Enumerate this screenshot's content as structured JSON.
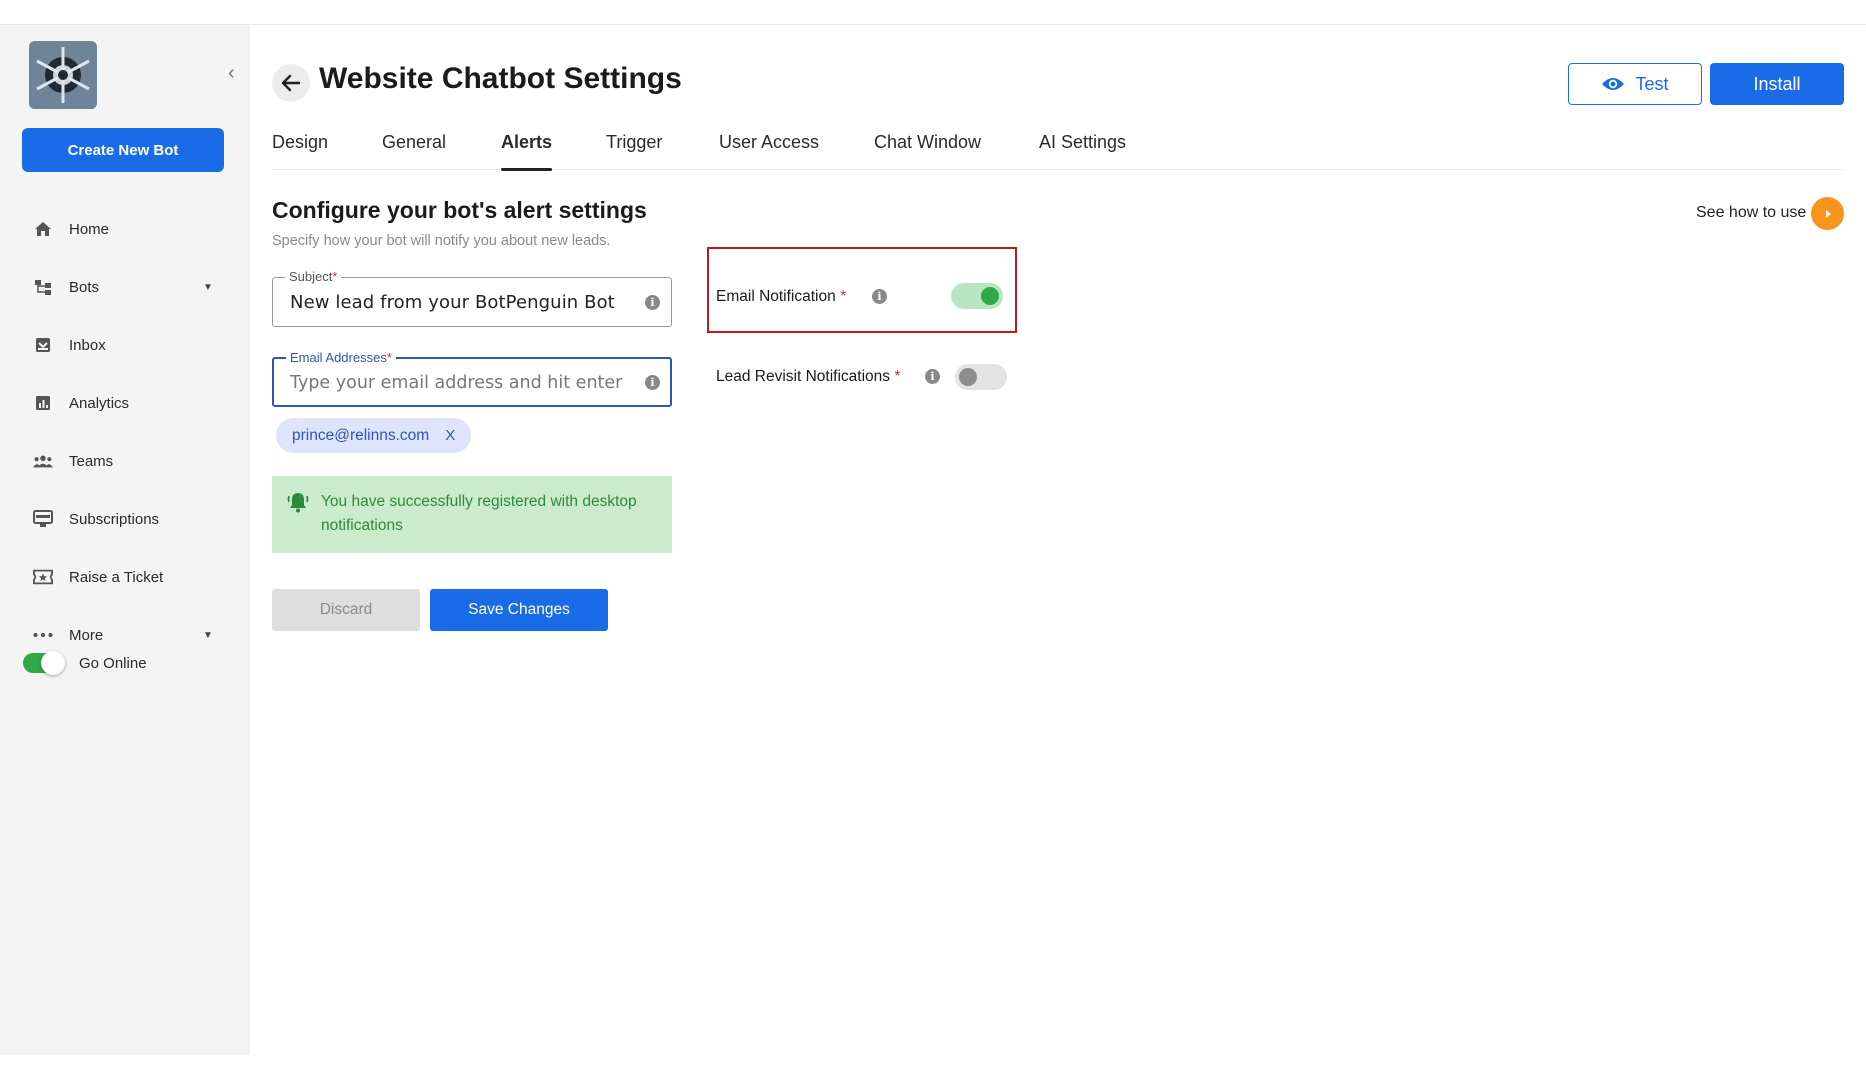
{
  "app": {
    "title": "Website Chatbot Settings",
    "create_button": "Create New Bot",
    "test_button": "Test",
    "install_button": "Install"
  },
  "sidebar": {
    "items": [
      {
        "label": "Home",
        "icon": "home-icon"
      },
      {
        "label": "Bots",
        "icon": "bots-icon",
        "has_caret": true
      },
      {
        "label": "Inbox",
        "icon": "inbox-icon"
      },
      {
        "label": "Analytics",
        "icon": "analytics-icon"
      },
      {
        "label": "Teams",
        "icon": "teams-icon"
      },
      {
        "label": "Subscriptions",
        "icon": "subscriptions-icon"
      },
      {
        "label": "Raise a Ticket",
        "icon": "ticket-icon"
      },
      {
        "label": "More",
        "icon": "more-icon",
        "has_caret": true
      }
    ],
    "online_label": "Go Online",
    "online_state": true
  },
  "tabs": [
    {
      "label": "Design"
    },
    {
      "label": "General"
    },
    {
      "label": "Alerts",
      "active": true
    },
    {
      "label": "Trigger"
    },
    {
      "label": "User Access"
    },
    {
      "label": "Chat Window"
    },
    {
      "label": "AI Settings"
    }
  ],
  "alerts": {
    "title": "Configure your bot's alert settings",
    "subtitle": "Specify how your bot will notify you about new leads.",
    "see_how": "See how to use",
    "subject": {
      "label": "Subject",
      "required_mark": "*",
      "value": "New lead from your BotPenguin Bot"
    },
    "email": {
      "label": "Email Addresses",
      "required_mark": "*",
      "placeholder": "Type your email address and hit enter"
    },
    "chip": {
      "email": "prince@relinns.com",
      "remove": "X"
    },
    "success_message": "You have successfully registered with desktop notifications",
    "discard_button": "Discard",
    "save_button": "Save Changes",
    "email_notification": {
      "label": "Email Notification",
      "required_mark": "*",
      "enabled": true
    },
    "lead_revisit": {
      "label": "Lead Revisit Notifications",
      "required_mark": "*",
      "enabled": false
    }
  },
  "colors": {
    "primary": "#1a6be8",
    "success_bg": "#cbeccb",
    "success_text": "#2d8a3a",
    "highlight": "#c01b1b",
    "accent_orange": "#f7941d"
  }
}
